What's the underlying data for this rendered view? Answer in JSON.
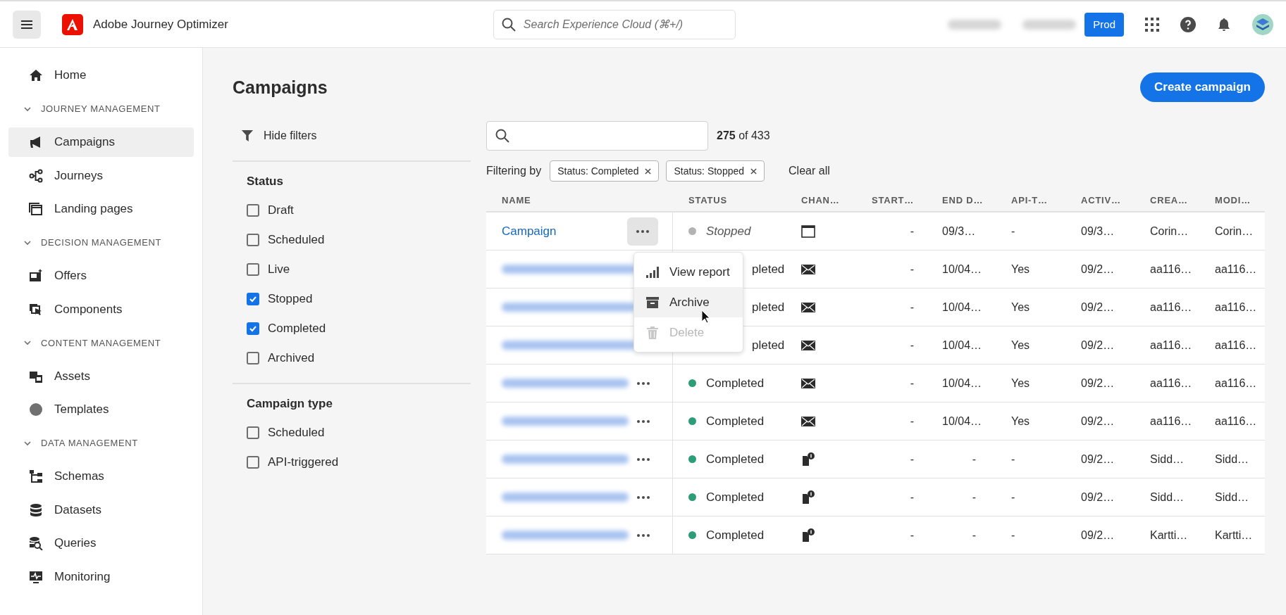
{
  "top_bar": {
    "app_title": "Adobe Journey Optimizer",
    "search": {
      "placeholder": "Search Experience Cloud (⌘+/)"
    },
    "environment_button": "Prod"
  },
  "sidebar": {
    "items": [
      {
        "kind": "item",
        "label": "Home",
        "selected": false
      },
      {
        "kind": "section",
        "label": "JOURNEY MANAGEMENT",
        "expanded": true
      },
      {
        "kind": "item",
        "label": "Campaigns",
        "selected": true
      },
      {
        "kind": "item",
        "label": "Journeys",
        "selected": false
      },
      {
        "kind": "item",
        "label": "Landing pages",
        "selected": false
      },
      {
        "kind": "section",
        "label": "DECISION MANAGEMENT",
        "expanded": true
      },
      {
        "kind": "item",
        "label": "Offers",
        "selected": false
      },
      {
        "kind": "item",
        "label": "Components",
        "selected": false
      },
      {
        "kind": "section",
        "label": "CONTENT MANAGEMENT",
        "expanded": true
      },
      {
        "kind": "item",
        "label": "Assets",
        "selected": false
      },
      {
        "kind": "item",
        "label": "Templates",
        "selected": false
      },
      {
        "kind": "section",
        "label": "DATA MANAGEMENT",
        "expanded": true
      },
      {
        "kind": "item",
        "label": "Schemas",
        "selected": false
      },
      {
        "kind": "item",
        "label": "Datasets",
        "selected": false
      },
      {
        "kind": "item",
        "label": "Queries",
        "selected": false
      },
      {
        "kind": "item",
        "label": "Monitoring",
        "selected": false
      }
    ]
  },
  "page": {
    "title": "Campaigns",
    "create_button": "Create campaign"
  },
  "filters": {
    "toggle": "Hide filters",
    "groups": [
      {
        "title": "Status",
        "options": [
          {
            "label": "Draft",
            "checked": false
          },
          {
            "label": "Scheduled",
            "checked": false
          },
          {
            "label": "Live",
            "checked": false
          },
          {
            "label": "Stopped",
            "checked": true
          },
          {
            "label": "Completed",
            "checked": true
          },
          {
            "label": "Archived",
            "checked": false
          }
        ]
      },
      {
        "title": "Campaign type",
        "options": [
          {
            "label": "Scheduled",
            "checked": false
          },
          {
            "label": "API-triggered",
            "checked": false
          }
        ]
      }
    ]
  },
  "search": {
    "count": "**275** of 433"
  },
  "filtering": {
    "label": "Filtering by",
    "tags": [
      "Status: Completed",
      "Status: Stopped"
    ],
    "clear": "Clear all"
  },
  "table": {
    "columns": [
      "NAME",
      "STATUS",
      "CHAN…",
      "START…",
      "END D…",
      "API-T…",
      "ACTIV…",
      "CREA…",
      "MODI…"
    ],
    "rows": [
      {
        "kind": "web",
        "name": "Campaign",
        "blurred": false,
        "menu_open": true,
        "status": "Stopped",
        "stopped": true,
        "color": "#b3b3b3",
        "start": "-",
        "end": "09/3…",
        "api": "-",
        "activated": "09/3…",
        "created_by": "Corin…",
        "modified_by": "Corin…"
      },
      {
        "kind": "email",
        "blurred": true,
        "status": "pleted",
        "stopped": false,
        "start": "-",
        "end": "10/04…",
        "api": "Yes",
        "activated": "09/2…",
        "created_by": "aa116…",
        "modified_by": "aa116…"
      },
      {
        "kind": "email",
        "blurred": true,
        "status": "pleted",
        "stopped": false,
        "start": "-",
        "end": "10/04…",
        "api": "Yes",
        "activated": "09/2…",
        "created_by": "aa116…",
        "modified_by": "aa116…"
      },
      {
        "kind": "email",
        "blurred": true,
        "status": "pleted",
        "stopped": false,
        "start": "-",
        "end": "10/04…",
        "api": "Yes",
        "activated": "09/2…",
        "created_by": "aa116…",
        "modified_by": "aa116…"
      },
      {
        "kind": "email",
        "blurred": true,
        "menu_open": false,
        "status": "Completed",
        "stopped": false,
        "color": "#2d9d78",
        "start": "-",
        "end": "10/04…",
        "api": "Yes",
        "activated": "09/2…",
        "created_by": "aa116…",
        "modified_by": "aa116…"
      },
      {
        "kind": "email",
        "blurred": true,
        "menu_open": false,
        "status": "Completed",
        "stopped": false,
        "color": "#2d9d78",
        "start": "-",
        "end": "10/04…",
        "api": "Yes",
        "activated": "09/2…",
        "created_by": "aa116…",
        "modified_by": "aa116…"
      },
      {
        "kind": "push",
        "blurred": true,
        "menu_open": false,
        "status": "Completed",
        "stopped": false,
        "color": "#2d9d78",
        "start": "-",
        "end": "-",
        "api": "-",
        "activated": "09/2…",
        "created_by": "Sidd…",
        "modified_by": "Sidd…"
      },
      {
        "kind": "push",
        "blurred": true,
        "menu_open": false,
        "status": "Completed",
        "stopped": false,
        "color": "#2d9d78",
        "start": "-",
        "end": "-",
        "api": "-",
        "activated": "09/2…",
        "created_by": "Sidd…",
        "modified_by": "Sidd…"
      },
      {
        "kind": "push",
        "blurred": true,
        "menu_open": false,
        "status": "Completed",
        "stopped": false,
        "color": "#2d9d78",
        "start": "-",
        "end": "-",
        "api": "-",
        "activated": "09/2…",
        "created_by": "Kartti…",
        "modified_by": "Kartti…"
      }
    ]
  },
  "row_menu": {
    "items": [
      {
        "label": "View report",
        "disabled": false,
        "selected": false
      },
      {
        "label": "Archive",
        "disabled": false,
        "selected": true
      },
      {
        "label": "Delete",
        "disabled": true,
        "selected": false
      }
    ]
  }
}
